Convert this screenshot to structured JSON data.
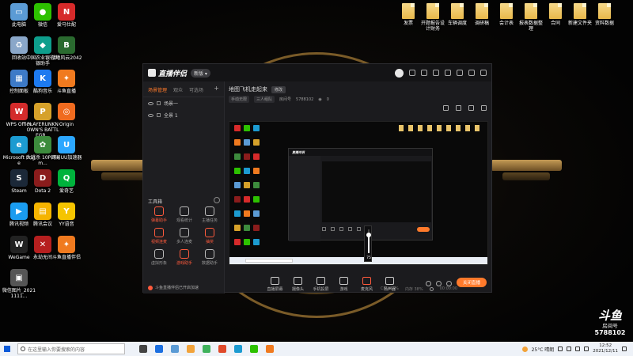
{
  "desktop": {
    "left_icons": [
      {
        "label": "此电脑",
        "color": "#5b9bd5",
        "glyph": "▭"
      },
      {
        "label": "微信",
        "color": "#2dc100",
        "glyph": "●"
      },
      {
        "label": "爱马仕配",
        "color": "#d62a2a",
        "glyph": "N"
      },
      {
        "label": "回收站",
        "color": "#8aa7c9",
        "glyph": "♻"
      },
      {
        "label": "中国农业银行网银助手",
        "color": "#0e9e8c",
        "glyph": "◆"
      },
      {
        "label": "战地风云2042",
        "color": "#2a6a2f",
        "glyph": "B"
      },
      {
        "label": "控制面板",
        "color": "#3d7ac7",
        "glyph": "▦"
      },
      {
        "label": "酷狗音乐",
        "color": "#1d7af0",
        "glyph": "K"
      },
      {
        "label": "斗鱼直播",
        "color": "#f07a1f",
        "glyph": "✦"
      },
      {
        "label": "WPS Office",
        "color": "#d32b2b",
        "glyph": "W"
      },
      {
        "label": "PLAYERUNKNOWN'S BATTLEGR...",
        "color": "#d6a12a",
        "glyph": "P"
      },
      {
        "label": "Origin",
        "color": "#f06b1f",
        "glyph": "◎"
      },
      {
        "label": "Microsoft Edge",
        "color": "#1c9bd1",
        "glyph": "e"
      },
      {
        "label": "大逃杀 10Pcflxm...",
        "color": "#3d8b3d",
        "glyph": "✿"
      },
      {
        "label": "网易UU加速器",
        "color": "#2ca7ff",
        "glyph": "U"
      },
      {
        "label": "Steam",
        "color": "#1b2838",
        "glyph": "S"
      },
      {
        "label": "Dota 2",
        "color": "#8a1c1c",
        "glyph": "D"
      },
      {
        "label": "爱奇艺",
        "color": "#00b33c",
        "glyph": "Q"
      },
      {
        "label": "腾讯视频",
        "color": "#1a9cf0",
        "glyph": "▶"
      },
      {
        "label": "腾讯会议",
        "color": "#f5b400",
        "glyph": "▤"
      },
      {
        "label": "YY语音",
        "color": "#f5c400",
        "glyph": "Y"
      },
      {
        "label": "WeGame",
        "color": "#222",
        "glyph": "W"
      },
      {
        "label": "永劫无间",
        "color": "#b61f1f",
        "glyph": "✕"
      },
      {
        "label": "斗鱼直播伴侣",
        "color": "#f07a1f",
        "glyph": "✦"
      },
      {
        "label": "微信图片_20211111...",
        "color": "#555",
        "glyph": "▣"
      }
    ],
    "right_icons": [
      {
        "label": "发票"
      },
      {
        "label": "开题报告设计财务"
      },
      {
        "label": "车辆调度"
      },
      {
        "label": "调研稿"
      },
      {
        "label": "会计表"
      },
      {
        "label": "报表数据整理"
      },
      {
        "label": "合同"
      },
      {
        "label": "新建文件夹"
      },
      {
        "label": "资料数据"
      }
    ]
  },
  "app": {
    "name": "直播伴侣",
    "version_badge": "新版 ▾",
    "left_tabs": [
      "场景管理",
      "观众",
      "可选场"
    ],
    "scenes": [
      "场景一",
      "全景 1"
    ],
    "toolbox_title": "工具箱",
    "tools": [
      {
        "label": "弹幕助手",
        "hot": true
      },
      {
        "label": "观看统计",
        "hot": false
      },
      {
        "label": "主播任务",
        "hot": false
      },
      {
        "label": "视频连麦",
        "hot": true
      },
      {
        "label": "多人连麦",
        "hot": false
      },
      {
        "label": "抽奖",
        "hot": true
      },
      {
        "label": "虚拟形象",
        "hot": false
      },
      {
        "label": "游戏助手",
        "hot": true
      },
      {
        "label": "数据助手",
        "hot": false
      }
    ],
    "ticker": "斗鱼直播伴侣已开启加速",
    "room_title": "地图飞机走起来",
    "room_badge": "修改",
    "room_category": "手动无限",
    "room_tag": "三人组队",
    "room_label": "房间号",
    "room_number": "5788102",
    "room_viewers": "0",
    "bottom_tools": [
      {
        "label": "直播屏幕"
      },
      {
        "label": "摄像头"
      },
      {
        "label": "手机投屏"
      },
      {
        "label": "游戏"
      },
      {
        "label": "麦克风"
      },
      {
        "label": "扬声器"
      }
    ],
    "go_live_label": "关闭直播",
    "mic_volume": 75,
    "status_items": [
      "CPU 12%",
      "内存 38%",
      "00:00:00"
    ]
  },
  "watermark": {
    "brand": "斗鱼",
    "room_text": "房间号",
    "room_number": "5788102"
  },
  "taskbar": {
    "search_placeholder": "在这里输入你要搜索的内容",
    "weather": "25°C 晴朗",
    "time": "12:52",
    "date": "2021/12/11",
    "app_colors": [
      "#444",
      "#1b6fe0",
      "#5b9bd5",
      "#f2a33a",
      "#3fb25c",
      "#e04a2b",
      "#1c9bd1",
      "#2dc100",
      "#f07a1f"
    ]
  }
}
